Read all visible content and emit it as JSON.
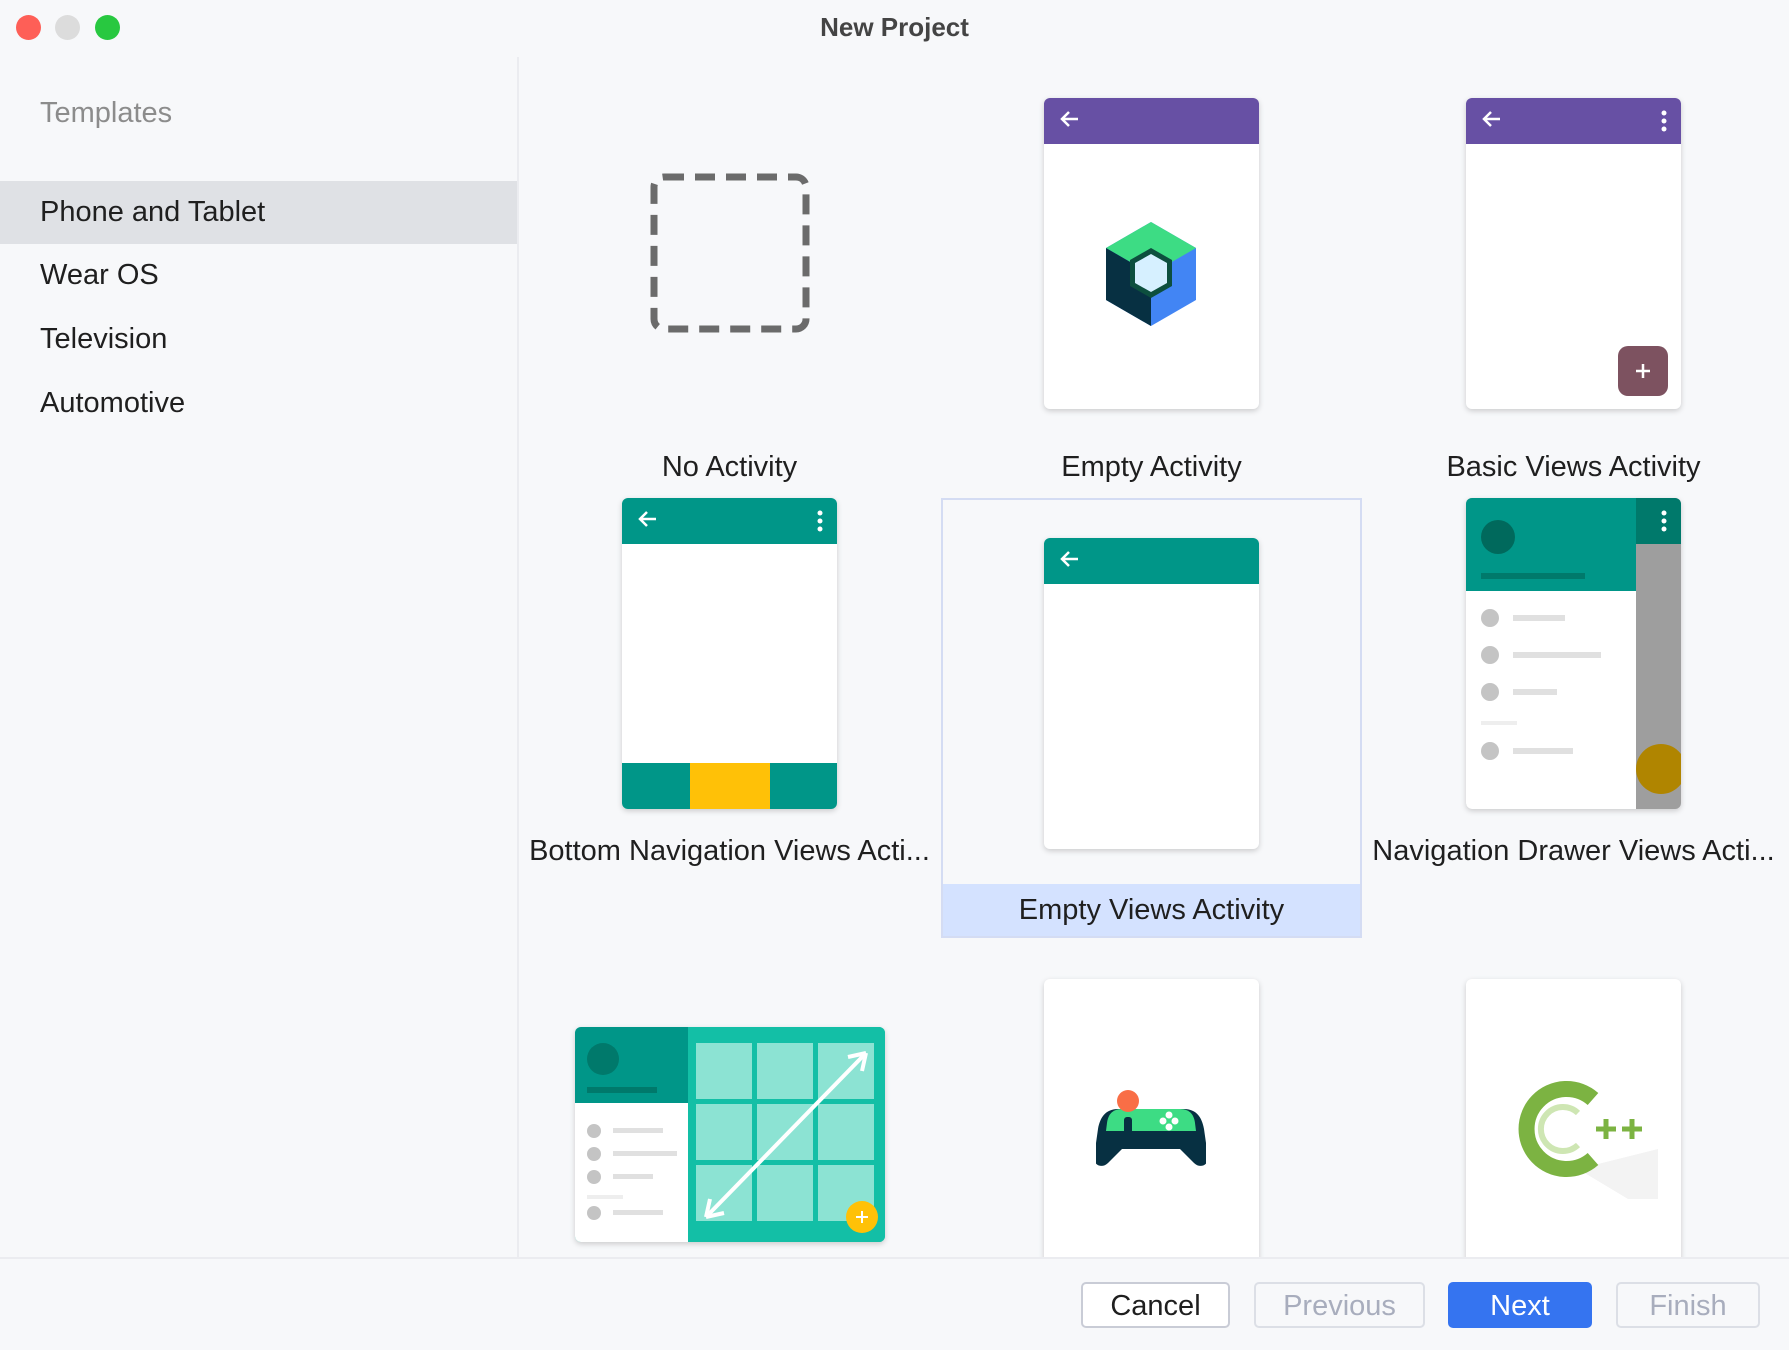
{
  "window": {
    "title": "New Project"
  },
  "sidebar": {
    "heading": "Templates",
    "items": [
      {
        "label": "Phone and Tablet",
        "selected": true
      },
      {
        "label": "Wear OS",
        "selected": false
      },
      {
        "label": "Television",
        "selected": false
      },
      {
        "label": "Automotive",
        "selected": false
      }
    ]
  },
  "templates": [
    {
      "label": "No Activity",
      "selected": false
    },
    {
      "label": "Empty Activity",
      "selected": false
    },
    {
      "label": "Basic Views Activity",
      "selected": false
    },
    {
      "label": "Bottom Navigation Views Acti...",
      "selected": false
    },
    {
      "label": "Empty Views Activity",
      "selected": true
    },
    {
      "label": "Navigation Drawer Views Acti...",
      "selected": false
    },
    {
      "label": "",
      "selected": false
    },
    {
      "label": "",
      "selected": false
    },
    {
      "label": "",
      "selected": false
    }
  ],
  "footer": {
    "cancel": "Cancel",
    "previous": "Previous",
    "next": "Next",
    "finish": "Finish"
  },
  "colors": {
    "accent": "#3574f0",
    "purple_appbar": "#6750a4",
    "teal_appbar": "#009688",
    "dark_teal": "#00796b",
    "fab_amber": "#ffc107",
    "fab_mauve": "#7d5260",
    "selection": "#d4e2ff"
  }
}
